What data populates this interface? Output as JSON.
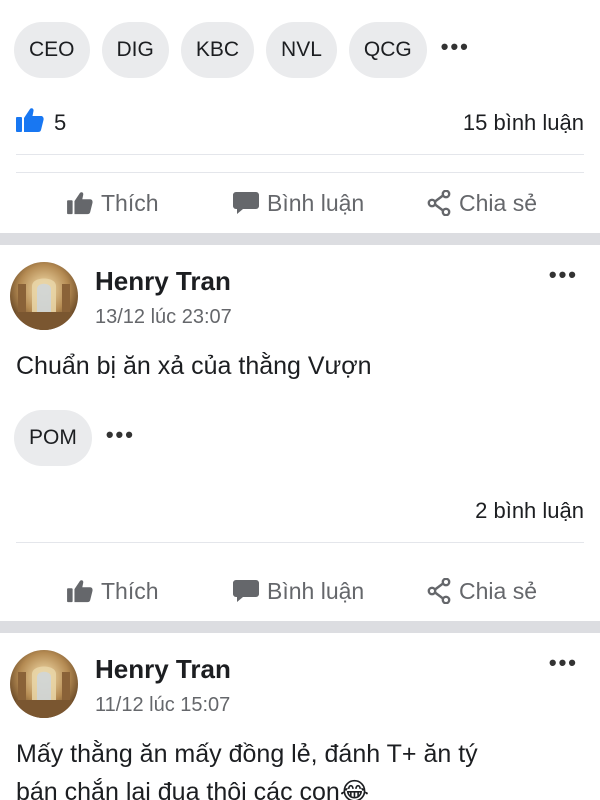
{
  "top_post": {
    "tags": [
      "CEO",
      "DIG",
      "KBC",
      "NVL",
      "QCG"
    ],
    "more_tags": "•••",
    "like_count": "5",
    "comment_count": "15 bình luận"
  },
  "actions": {
    "like": "Thích",
    "comment": "Bình luận",
    "share": "Chia sẻ"
  },
  "posts": [
    {
      "author": "Henry Tran",
      "time": "13/12 lúc 23:07",
      "text": "Chuẩn bị ăn xả của thằng Vượn",
      "tags": [
        "POM"
      ],
      "more_tags": "•••",
      "comment_count": "2 bình luận",
      "menu": "•••"
    },
    {
      "author": "Henry Tran",
      "time": "11/12 lúc 15:07",
      "text_line1": "Mấy thằng ăn mấy đồng lẻ, đánh T+ ăn tý",
      "text_line2": "bán chắn lại đua thôi các con",
      "emoji": "😂",
      "menu": "•••"
    }
  ],
  "colors": {
    "like_blue": "#1877f2",
    "action_gray": "#65676b",
    "tag_bg": "#eaebed",
    "separator": "#dcdde1"
  }
}
